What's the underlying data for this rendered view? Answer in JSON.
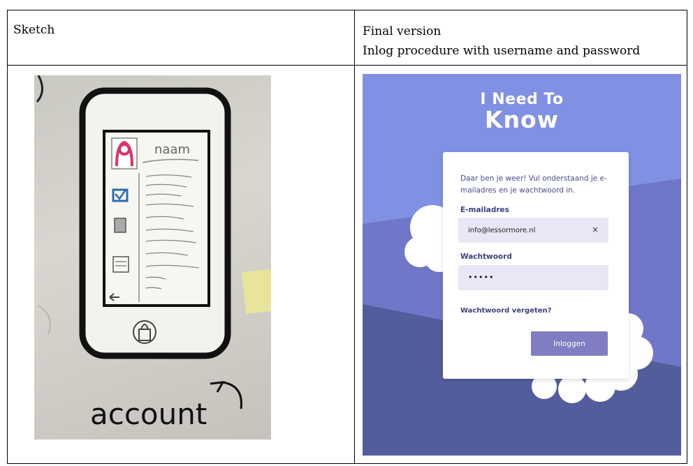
{
  "table": {
    "header_left": "Sketch",
    "header_right_line1": "Final version",
    "header_right_line2": "Inlog procedure with username and password"
  },
  "sketch": {
    "handwritten_words": [
      "naam",
      "account"
    ]
  },
  "app": {
    "brand_line1": "I Need To",
    "brand_line2": "Know",
    "intro_text": "Daar ben je weer! Vul onderstaand je e-mailadres en je wachtwoord in.",
    "email_label": "E-mailadres",
    "email_value": "info@lessormore.nl",
    "clear_symbol": "×",
    "password_label": "Wachtwoord",
    "password_value": "•••••",
    "forgot_link": "Wachtwoord vergeten?",
    "login_button": "Inloggen",
    "colors": {
      "background": "#7f8be0",
      "band_mid": "#6f76c4",
      "band_dark": "#545d9c",
      "button": "#7f7ec2",
      "field": "#e7e7f5",
      "label": "#3d3f80"
    }
  }
}
